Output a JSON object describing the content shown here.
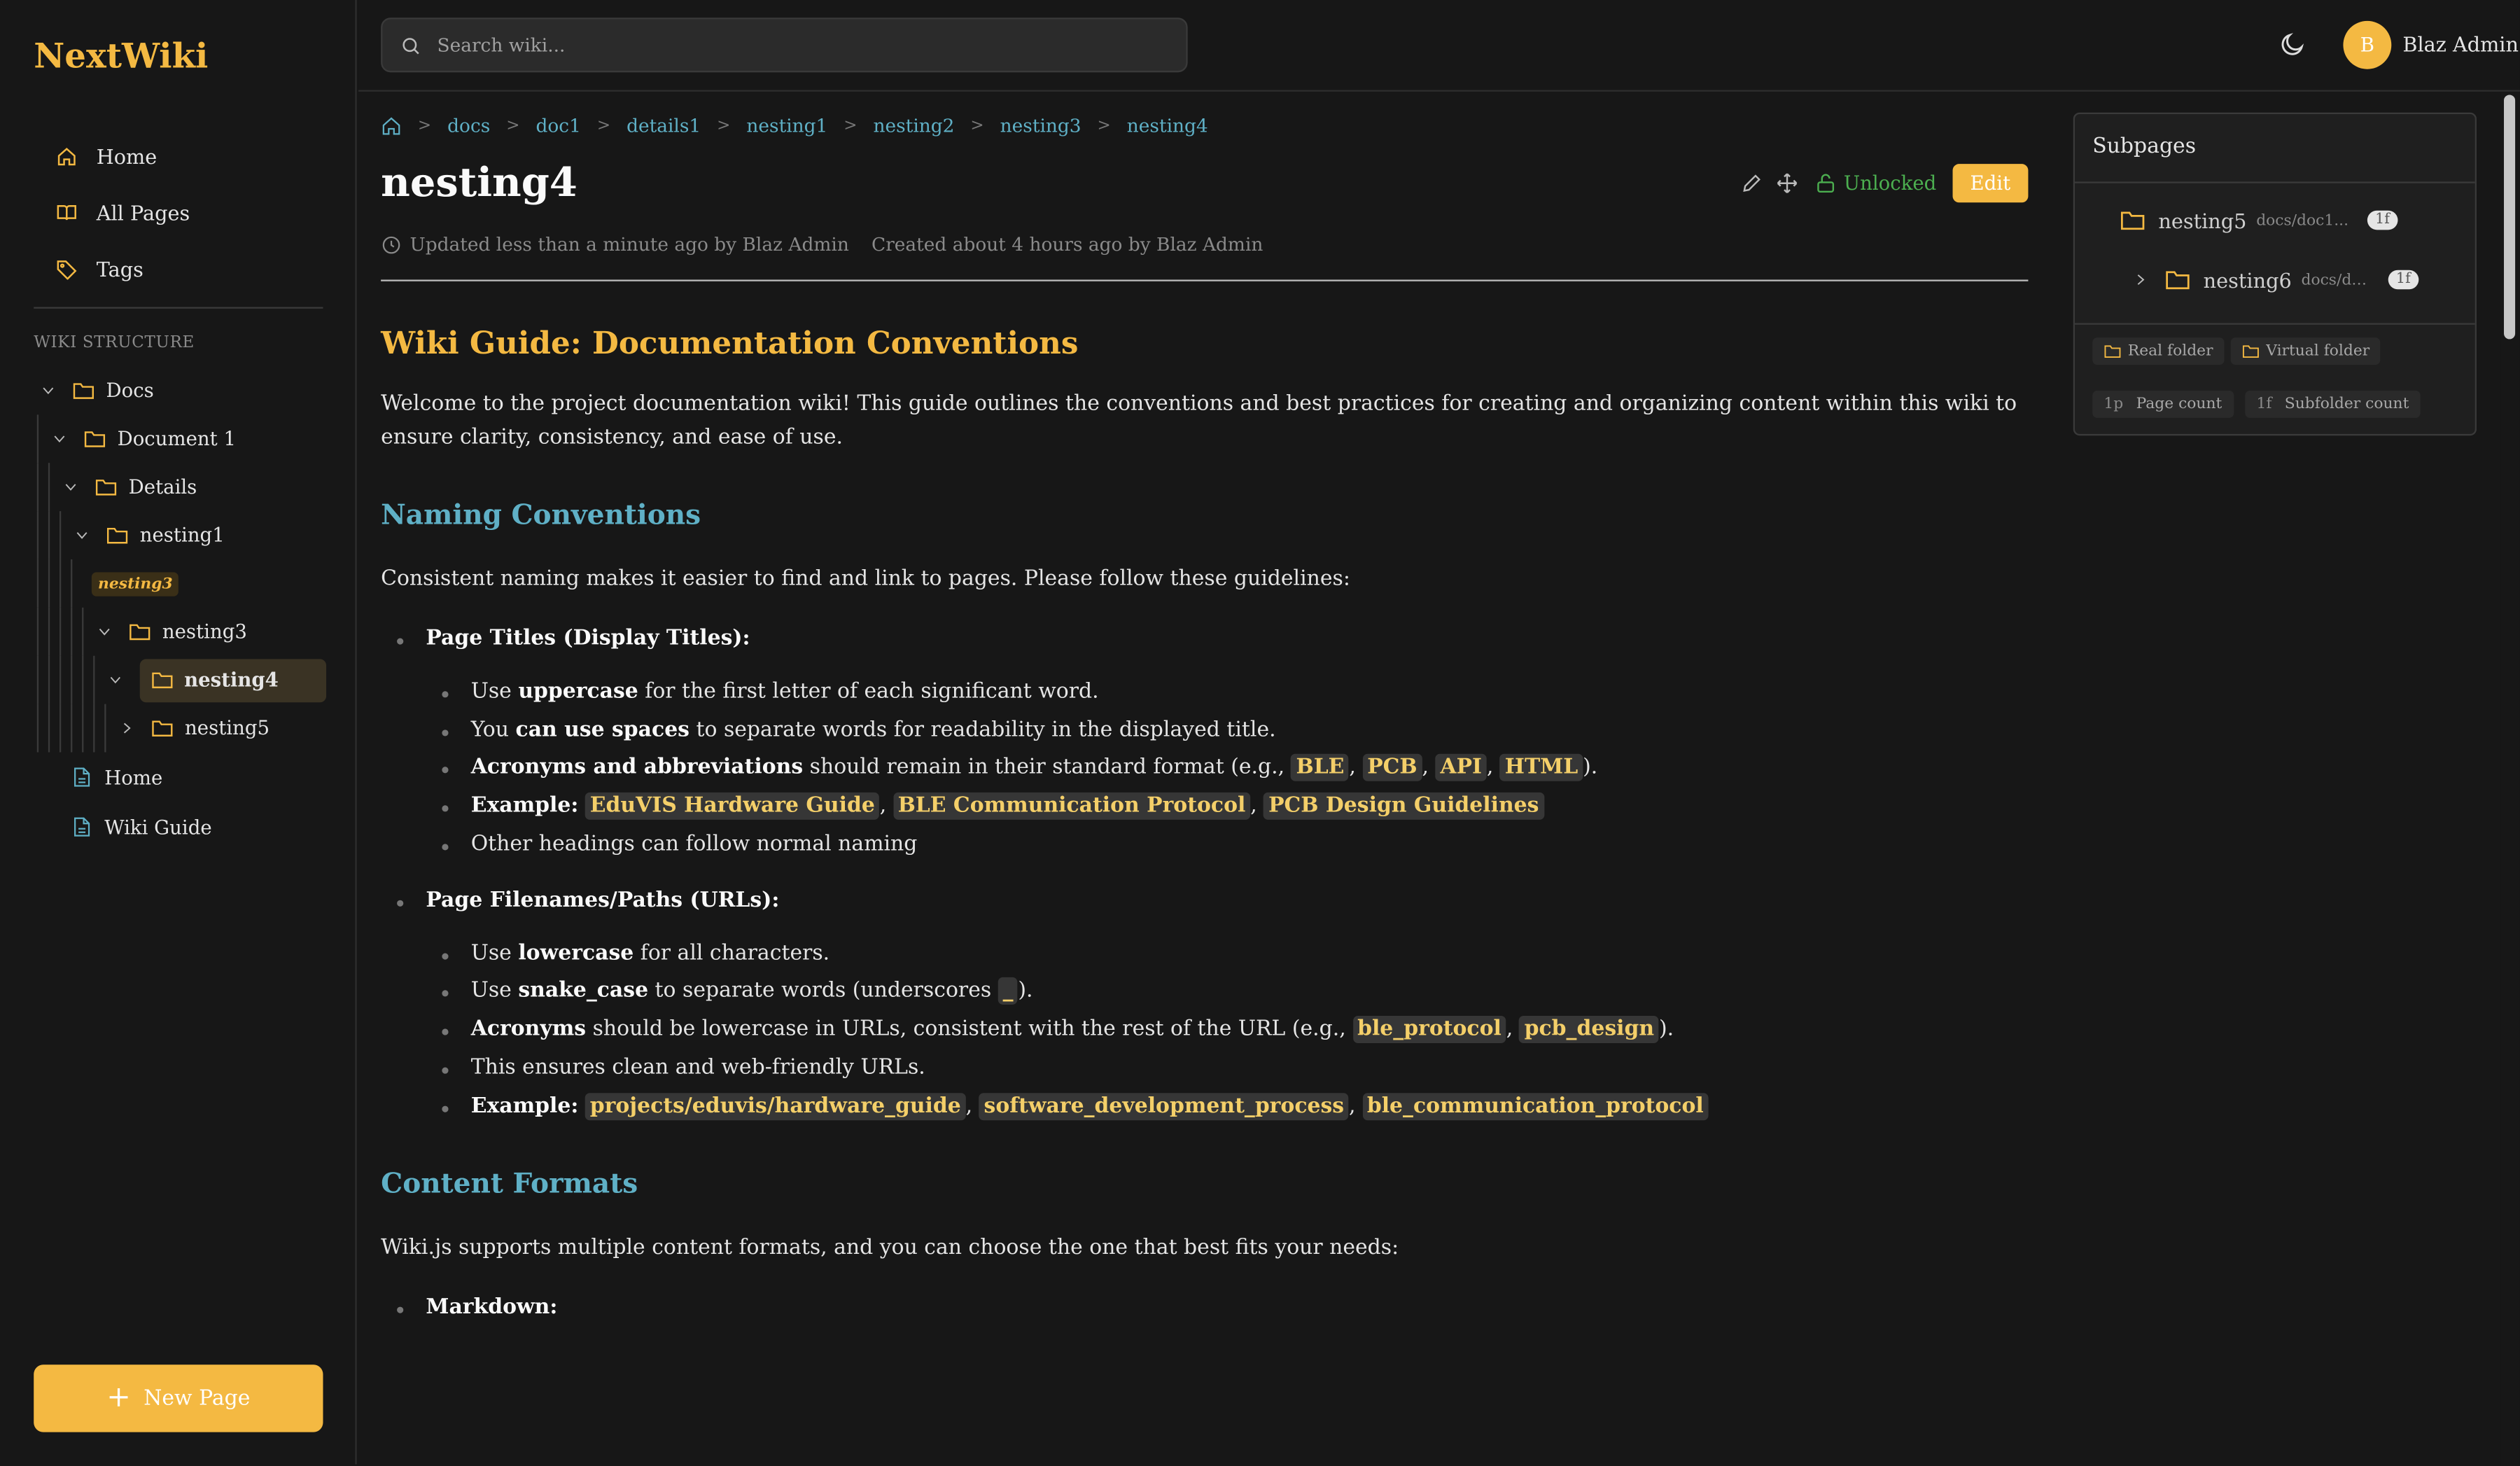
{
  "brand": "NextWiki",
  "nav": [
    {
      "label": "Home",
      "icon": "home-icon"
    },
    {
      "label": "All Pages",
      "icon": "book-icon"
    },
    {
      "label": "Tags",
      "icon": "tag-icon"
    }
  ],
  "wiki_structure": {
    "title": "WIKI STRUCTURE",
    "tree": {
      "docs": "Docs",
      "document1": "Document 1",
      "details": "Details",
      "nesting1": "nesting1",
      "nesting3_tag": "nesting3",
      "nesting3": "nesting3",
      "nesting4": "nesting4",
      "nesting5": "nesting5",
      "home": "Home",
      "wiki_guide": "Wiki Guide"
    }
  },
  "new_page_label": "New Page",
  "search": {
    "placeholder": "Search wiki..."
  },
  "user": {
    "initial": "B",
    "name": "Blaz Admin"
  },
  "breadcrumbs": [
    "docs",
    "doc1",
    "details1",
    "nesting1",
    "nesting2",
    "nesting3",
    "nesting4"
  ],
  "page": {
    "title": "nesting4",
    "lock_status": "Unlocked",
    "edit_label": "Edit",
    "updated": "Updated less than a minute ago by Blaz Admin",
    "created": "Created about 4 hours ago by Blaz Admin"
  },
  "content": {
    "h1": "Wiki Guide: Documentation Conventions",
    "intro": "Welcome to the project documentation wiki! This guide outlines the conventions and best practices for creating and organizing content within this wiki to ensure clarity, consistency, and ease of use.",
    "naming": {
      "heading": "Naming Conventions",
      "intro": "Consistent naming makes it easier to find and link to pages. Please follow these guidelines:",
      "titles_label": "Page Titles (Display Titles):",
      "t1a": "Use ",
      "t1b": "uppercase",
      "t1c": " for the first letter of each significant word.",
      "t2a": "You ",
      "t2b": "can use spaces",
      "t2c": " to separate words for readability in the displayed title.",
      "t3a": "Acronyms and abbreviations",
      "t3b": " should remain in their standard format (e.g., ",
      "t3codes": [
        "BLE",
        "PCB",
        "API",
        "HTML"
      ],
      "t3end": ").",
      "t4a": "Example:",
      "t4codes": [
        "EduVIS Hardware Guide",
        "BLE Communication Protocol",
        "PCB Design Guidelines"
      ],
      "t5": "Other headings can follow normal naming",
      "paths_label": "Page Filenames/Paths (URLs):",
      "p1a": "Use ",
      "p1b": "lowercase",
      "p1c": " for all characters.",
      "p2a": "Use ",
      "p2b": "snake_case",
      "p2c": " to separate words (underscores ",
      "p2code": "_",
      "p2end": ").",
      "p3a": "Acronyms",
      "p3b": " should be lowercase in URLs, consistent with the rest of the URL (e.g., ",
      "p3codes": [
        "ble_protocol",
        "pcb_design"
      ],
      "p3end": ").",
      "p4": "This ensures clean and web-friendly URLs.",
      "p5a": "Example:",
      "p5codes": [
        "projects/eduvis/hardware_guide",
        "software_development_process",
        "ble_communication_protocol"
      ]
    },
    "formats": {
      "heading": "Content Formats",
      "intro": "Wiki.js supports multiple content formats, and you can choose the one that best fits your needs:",
      "markdown_label": "Markdown:"
    }
  },
  "subpages": {
    "title": "Subpages",
    "items": [
      {
        "name": "nesting5",
        "path": "docs/doc1...",
        "badge": "1f"
      },
      {
        "name": "nesting6",
        "path": "docs/do...",
        "badge": "1f"
      }
    ],
    "legend": {
      "real_folder": "Real folder",
      "virtual_folder": "Virtual folder",
      "page_count_key": "1p",
      "page_count": "Page count",
      "subfolder_count_key": "1f",
      "subfolder_count": "Subfolder count"
    }
  },
  "colors": {
    "accent": "#f4b942",
    "link": "#5fb0c6",
    "background": "#171717",
    "success": "#4caf50"
  }
}
